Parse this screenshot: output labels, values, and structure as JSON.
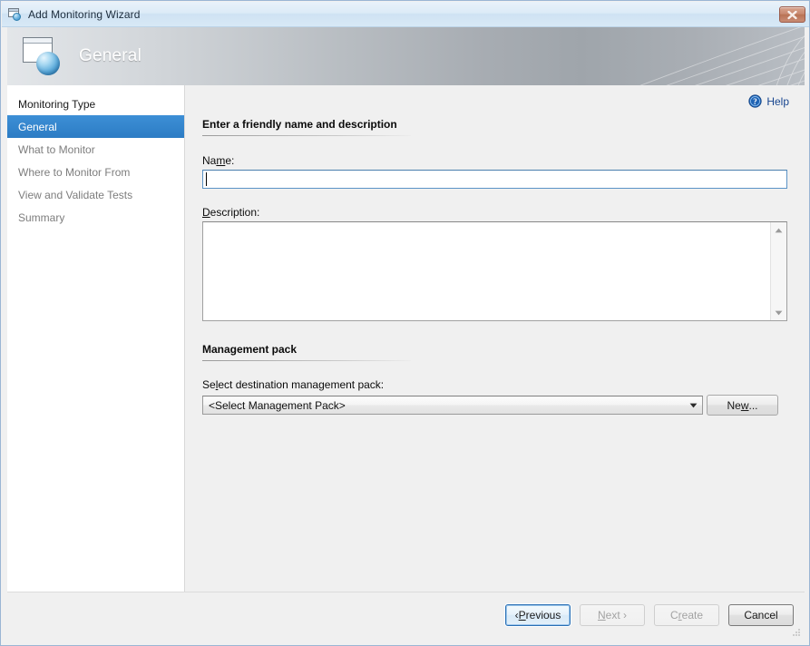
{
  "window": {
    "title": "Add Monitoring Wizard",
    "icon": "monitor-globe-icon",
    "close_label": "×"
  },
  "banner": {
    "title": "General",
    "icon": "monitor-globe-icon"
  },
  "sidebar": {
    "items": [
      {
        "label": "Monitoring Type",
        "state": "done"
      },
      {
        "label": "General",
        "state": "active"
      },
      {
        "label": "What to Monitor",
        "state": "pending"
      },
      {
        "label": "Where to Monitor From",
        "state": "pending"
      },
      {
        "label": "View and Validate Tests",
        "state": "pending"
      },
      {
        "label": "Summary",
        "state": "pending"
      }
    ]
  },
  "content": {
    "help": {
      "label": "Help",
      "icon": "help-circle-icon"
    },
    "section_general": {
      "heading": "Enter a friendly name and description",
      "name": {
        "label_pre": "Na",
        "label_key": "m",
        "label_post": "e:",
        "value": "",
        "placeholder": ""
      },
      "description": {
        "label_key": "D",
        "label_post": "escription:",
        "value": "",
        "placeholder": ""
      }
    },
    "section_mp": {
      "heading": "Management pack",
      "select_label_pre": "Se",
      "select_label_key": "l",
      "select_label_post": "ect destination management pack:",
      "combo_value": "<Select Management Pack>",
      "new_button": {
        "pre": "Ne",
        "key": "w",
        "post": "..."
      }
    }
  },
  "footer": {
    "buttons": [
      {
        "name": "previous",
        "pre": "‹ ",
        "key": "P",
        "post": "revious",
        "state": "focus"
      },
      {
        "name": "next",
        "pre": "",
        "key": "N",
        "post": "ext ›",
        "state": "disabled"
      },
      {
        "name": "create",
        "pre": "C",
        "key": "r",
        "post": "eate",
        "state": "disabled"
      },
      {
        "name": "cancel",
        "pre": "",
        "key": "",
        "post": "Cancel",
        "state": "normal"
      }
    ]
  },
  "colors": {
    "accent": "#2c7cc4",
    "titlebar": "#d8e9f6",
    "close_button": "#b97355",
    "help_link": "#17458f",
    "content_bg": "#f0f0f0"
  }
}
